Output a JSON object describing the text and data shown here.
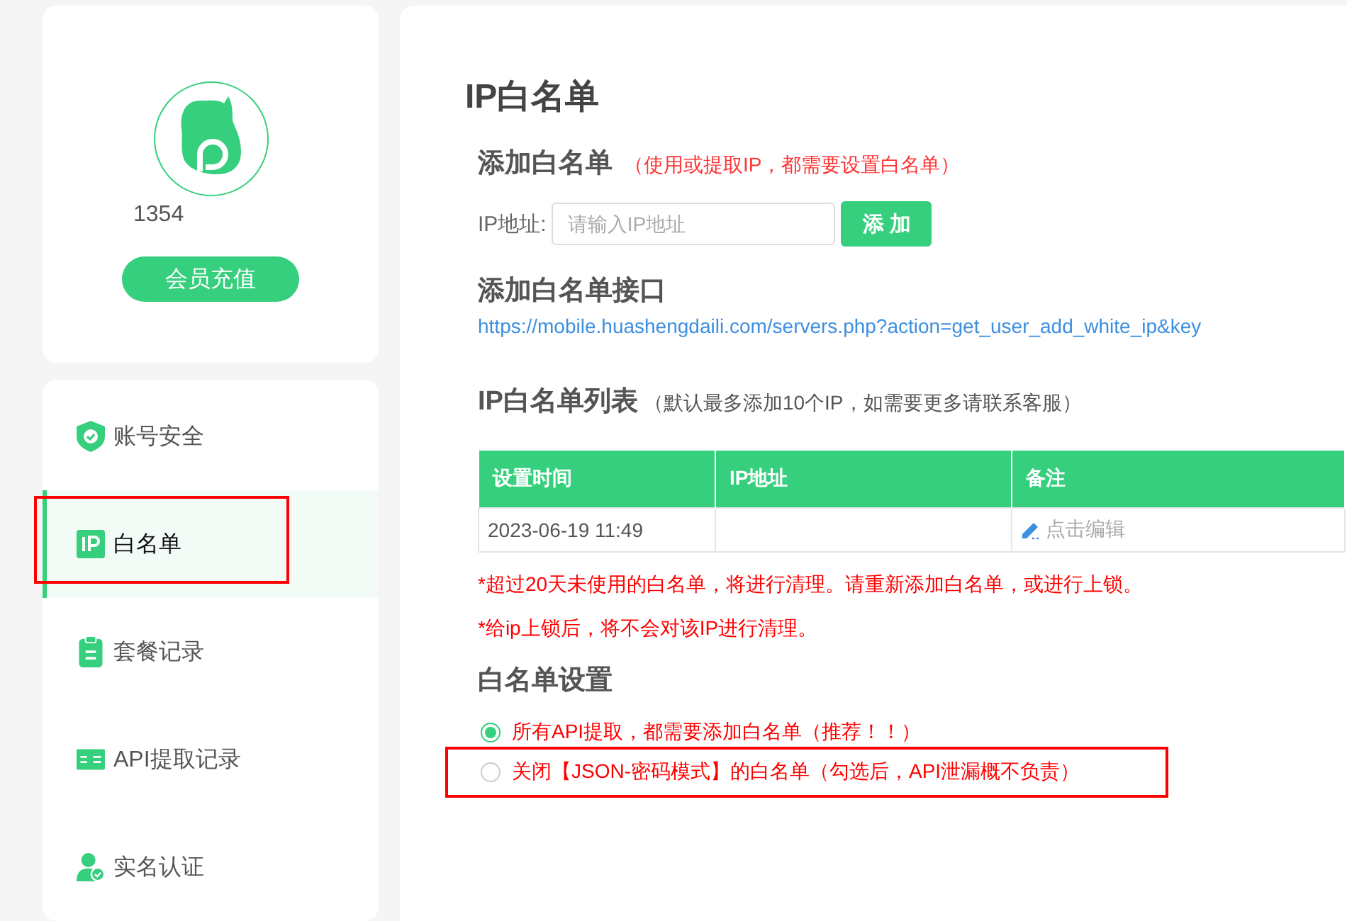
{
  "profile": {
    "username": "1354",
    "recharge_button": "会员充值"
  },
  "nav": [
    {
      "label": "账号安全",
      "kind": "shield",
      "selected": false,
      "highlighted": false
    },
    {
      "label": "白名单",
      "kind": "ip",
      "selected": true,
      "highlighted": true
    },
    {
      "label": "套餐记录",
      "kind": "clipboard",
      "selected": false,
      "highlighted": false
    },
    {
      "label": "API提取记录",
      "kind": "card",
      "selected": false,
      "highlighted": false
    },
    {
      "label": "实名认证",
      "kind": "user",
      "selected": false,
      "highlighted": false
    }
  ],
  "page_title": "IP白名单",
  "add_section": {
    "title": "添加白名单",
    "note": "（使用或提取IP，都需要设置白名单）",
    "field_label": "IP地址:",
    "placeholder": "请输入IP地址",
    "button": "添 加"
  },
  "api_section": {
    "title": "添加白名单接口",
    "url": "https://mobile.huashengdaili.com/servers.php?action=get_user_add_white_ip&key"
  },
  "list_section": {
    "title": "IP白名单列表",
    "note": "（默认最多添加10个IP，如需要更多请联系客服）"
  },
  "table": {
    "columns": [
      "设置时间",
      "IP地址",
      "备注"
    ],
    "rows": [
      {
        "time": "2023-06-19 11:49",
        "ip": "",
        "remark": "点击编辑"
      }
    ]
  },
  "warnings": [
    "*超过20天未使用的白名单，将进行清理。请重新添加白名单，或进行上锁。",
    "*给ip上锁后，将不会对该IP进行清理。"
  ],
  "settings": {
    "title": "白名单设置",
    "options": [
      {
        "label": "所有API提取，都需要添加白名单（推荐！！）",
        "selected": true,
        "highlighted": false
      },
      {
        "label": "关闭【JSON-密码模式】的白名单（勾选后，API泄漏概不负责）",
        "selected": false,
        "highlighted": true
      }
    ]
  }
}
